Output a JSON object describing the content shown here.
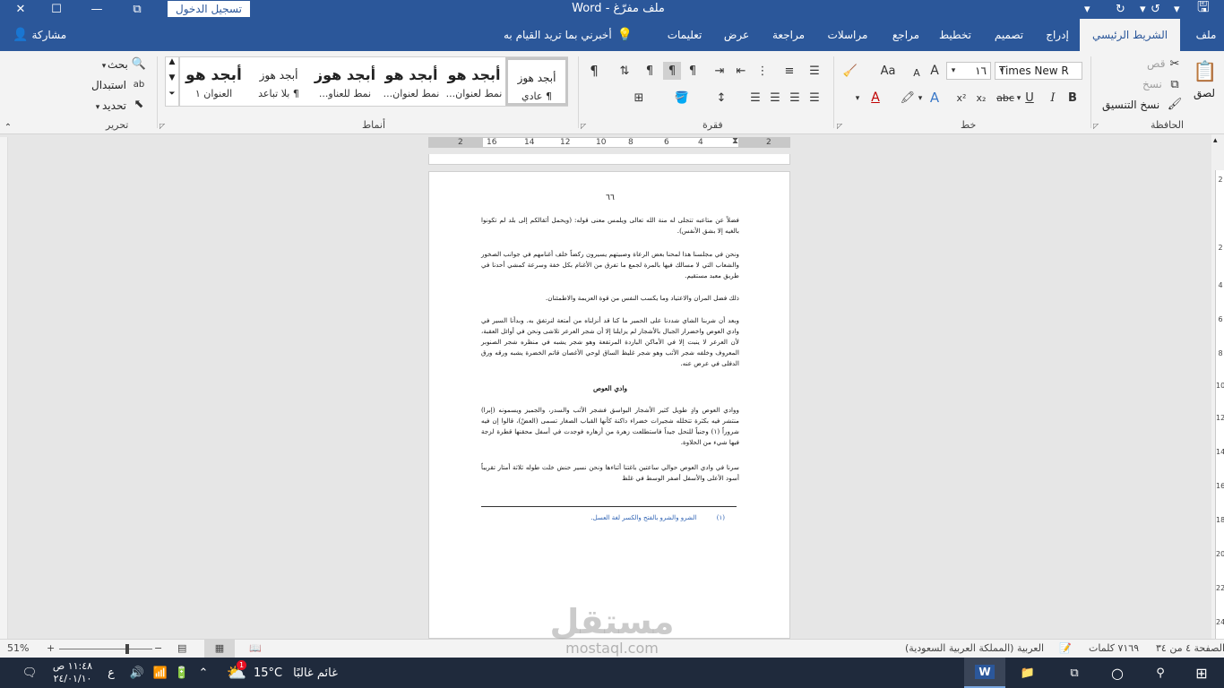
{
  "app": {
    "document_title": "ملف مفرّغ",
    "app_name": "Word",
    "sign_in": "تسجيل الدخول"
  },
  "window_controls": {
    "close": "✕",
    "maximize": "☐",
    "minimize": "—",
    "ribbon_display": "⧉"
  },
  "tabs": [
    {
      "label": "ملف",
      "active": false
    },
    {
      "label": "الشريط الرئيسي",
      "active": true
    },
    {
      "label": "إدراج",
      "active": false
    },
    {
      "label": "تصميم",
      "active": false
    },
    {
      "label": "تخطيط",
      "active": false
    },
    {
      "label": "مراجع",
      "active": false
    },
    {
      "label": "مراسلات",
      "active": false
    },
    {
      "label": "مراجعة",
      "active": false
    },
    {
      "label": "عرض",
      "active": false
    },
    {
      "label": "تعليمات",
      "active": false
    }
  ],
  "tell_me": "أخبرني بما تريد القيام به",
  "share": "مشاركة",
  "clipboard": {
    "group": "الحافظة",
    "paste": "لصق",
    "cut": "قص",
    "copy": "نسخ",
    "format_painter": "نسخ التنسيق"
  },
  "font": {
    "group": "خط",
    "name": "Times New R",
    "size": "١٦",
    "bold": "B",
    "italic": "I",
    "underline": "U",
    "strike": "abc",
    "subscript": "x₂",
    "superscript": "x²",
    "grow": "A",
    "shrink": "A",
    "case": "Aa"
  },
  "paragraph": {
    "group": "فقرة"
  },
  "styles": {
    "group": "أنماط",
    "items": [
      {
        "preview": "أبجد هوز",
        "name": "¶ عادي",
        "selected": true
      },
      {
        "preview": "أبجد هو",
        "name": "نمط لعنوان...",
        "selected": false
      },
      {
        "preview": "أبجد هو",
        "name": "نمط لعنوان...",
        "selected": false
      },
      {
        "preview": "أبجد هوز",
        "name": "نمط للعناو...",
        "selected": false
      },
      {
        "preview": "أبجد هوز",
        "name": "¶ بلا تباعد",
        "selected": false
      },
      {
        "preview": "أبجد هو",
        "name": "العنوان ١",
        "selected": false
      }
    ]
  },
  "editing": {
    "group": "تحرير",
    "find": "بحث",
    "replace": "استبدال",
    "select": "تحديد"
  },
  "ruler": [
    "2",
    "2",
    "4",
    "6",
    "8",
    "10",
    "12",
    "14",
    "16"
  ],
  "vruler": [
    "2",
    "2",
    "4",
    "6",
    "8",
    "10",
    "12",
    "14",
    "16",
    "18",
    "20",
    "22",
    "24"
  ],
  "document": {
    "page_number": "٦٦",
    "paragraphs": [
      "فضلاً عن متاعبه تتجلى له منة الله تعالى ويلمس معنى قوله: (ويحمل أثقالكم إلى بلد لم تكونوا بالغيه إلا بشق الأنفس).",
      "ونحن في مجلسنا هذا لمحنا بعض الرعاة وصبيتهم يسيرون ركضاً خلف أغنامهم في جوانب الصخور والشعاب التي لا مسالك فيها بالمرة لجمع ما تفرق من الأغنام بكل خفة وسرعة كمشي أحدنا في طريق معبد مستقيم.",
      "ذلك فضل المران والاعتياد وما يكسب النفس من قوة العزيمة والاطمئنان.",
      "وبعد أن شربنا الشاي شددنا على الحمير ما كنا قد أنزلناه من أمتعة لنرتفق به. وبدأنا السير في وادي العوص واخضرار الجبال بالأشجار لم يزايلنا إلا أن شجر العرعر تلاشى ونحن في أوائل العقبة، لأن العرعر لا ينبت إلا في الأماكن الباردة المرتفعة وهو شجر يشبه في منظره شجر الصنوبر المعروف وخلفه شجر الأثب وهو شجر غليظ الساق لوحي الأغصان قاتم الخضرة يشبه ورقه ورق الدفلى في عرض عنه."
    ],
    "heading": "وادي العوص",
    "paragraphs2": [
      "ووادي العوص وادٍ طويل كثير الأشجار البواسق فشجر الأثب والسدر، والجميز ويسمونه (إبرا) منتشر فيه بكثرة تتخلله شجيرات خضراء داكنة كأنها القباب الصغار تسمى (العضْ)، قالوا إن فيه شروراً (١) وجنياً للنحل جيداً فاستطلعت زهرة من أزهاره فوجدت في أسفل محقنها قطرة لزجة فيها شيء من الحلاوة.",
      "سرنا في وادي العوص حوالي ساعتين باغتنا أثناءها ونحن نسير حنش خلت طوله ثلاثة أمتار تقريباً أسود الأعلى والأسفل أصفر الوسط في غلظ"
    ],
    "footnote_marker": "(١)",
    "footnote": "الشرو والشرو بالفتح والكسر لغة العسل."
  },
  "statusbar": {
    "page": "الصفحة ٤ من ٣٤",
    "words": "٧١٦٩ كلمات",
    "language": "العربية (المملكة العربية السعودية)",
    "zoom": "51%",
    "zoom_minus": "−",
    "zoom_plus": "+"
  },
  "taskbar": {
    "time": "١١:٤٨ ص",
    "date": "٢٤/٠١/١٠",
    "lang": "ع",
    "temperature": "15°C",
    "weather": "غائم غالبًا",
    "weather_badge": "1"
  },
  "watermark": {
    "logo": "مستقل",
    "url": "mostaql.com"
  }
}
